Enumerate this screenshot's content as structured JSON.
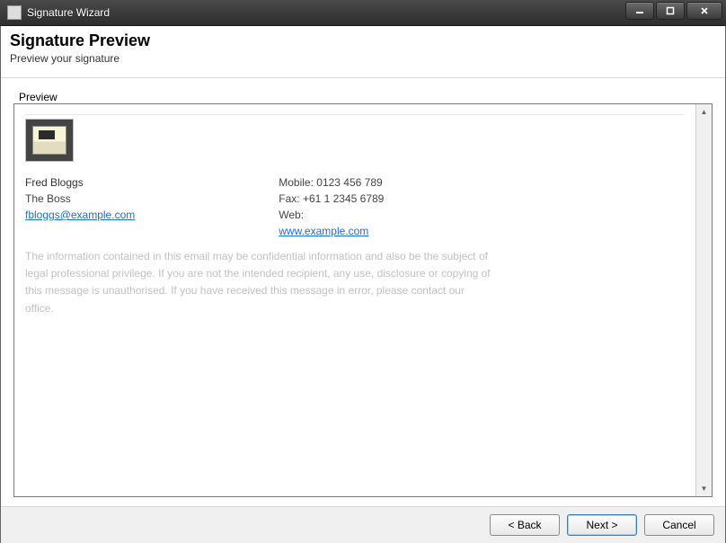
{
  "window": {
    "title": "Signature Wizard"
  },
  "header": {
    "title": "Signature Preview",
    "subtitle": "Preview your signature"
  },
  "groupbox": {
    "label": "Preview"
  },
  "signature": {
    "name": "Fred Bloggs",
    "title": "The Boss",
    "email": "fbloggs@example.com",
    "contact": {
      "mobile_label": "Mobile:",
      "mobile": "0123 456 789",
      "fax_label": "Fax:",
      "fax": "+61 1 2345 6789",
      "web_label": "Web:",
      "web": "www.example.com"
    },
    "disclaimer": "The information contained in this email may be confidential information and also be the subject of legal professional privilege. If you are not the intended recipient, any use, disclosure or copying of this message is unauthorised. If you have received this message in error, please contact our office."
  },
  "footer": {
    "back": "< Back",
    "next": "Next >",
    "cancel": "Cancel"
  }
}
